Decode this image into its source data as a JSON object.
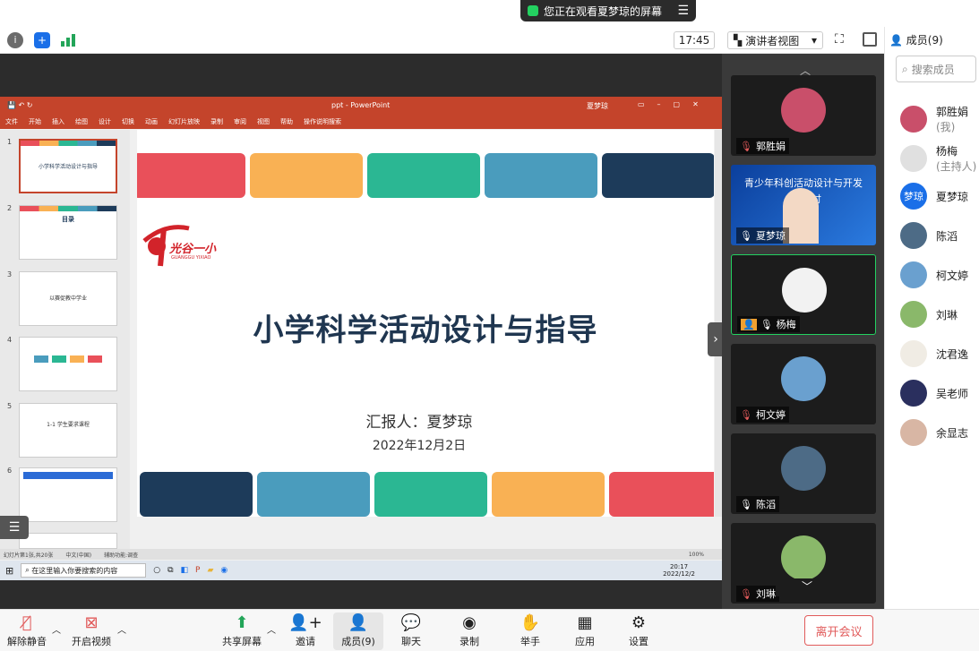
{
  "share_banner": {
    "text": "您正在观看夏梦琼的屏幕"
  },
  "topbar": {
    "time": "17:45",
    "view_mode": "演讲者视图"
  },
  "ppt": {
    "window_title": "ppt - PowerPoint",
    "user": "夏梦琼",
    "ribbon_tabs": [
      "文件",
      "开始",
      "插入",
      "绘图",
      "设计",
      "切换",
      "动画",
      "幻灯片放映",
      "录制",
      "审阅",
      "视图",
      "帮助",
      "操作说明搜索"
    ],
    "thumb_numbers": [
      "1",
      "2",
      "3",
      "4",
      "5",
      "6"
    ],
    "thumb_texts": [
      "小学科学活动设计与指导",
      "目录",
      "以赛促教中学业",
      "",
      "1-1 学生要求课程",
      ""
    ],
    "status": [
      "幻灯片第1张,共20张",
      "中文(中国)",
      "辅助功能:调查"
    ],
    "zoom": "100%"
  },
  "slide": {
    "logo_text": "光谷一小",
    "logo_sub": "GUANGGU YIXIAO",
    "title": "小学科学活动设计与指导",
    "reporter": "汇报人：夏梦琼",
    "date": "2022年12月2日",
    "top_colors": [
      "#e9505a",
      "#f9b154",
      "#2bb793",
      "#4a9cbd",
      "#1d3b5a"
    ],
    "bottom_colors": [
      "#1d3b5a",
      "#4a9cbd",
      "#2bb793",
      "#f9b154",
      "#e9505a"
    ]
  },
  "taskbar": {
    "search_placeholder": "在这里输入你要搜索的内容",
    "clock_time": "20:17",
    "clock_date": "2022/12/2"
  },
  "tiles": [
    {
      "name": "郭胜娟",
      "color": "#c94f6a"
    },
    {
      "name": "夏梦琼",
      "video_text": "青少年科创活动设计与开发",
      "video_text2": "讨",
      "color": "#2b6bd6"
    },
    {
      "name": "杨梅",
      "color": "#f2f2f2"
    },
    {
      "name": "柯文婷",
      "color": "#6aa0cf"
    },
    {
      "name": "陈滔",
      "color": "#4d6b86"
    },
    {
      "name": "刘琳",
      "color": "#8ab86a"
    }
  ],
  "members": {
    "title": "成员(9)",
    "search_placeholder": "搜索成员",
    "list": [
      {
        "name": "郭胜娟",
        "sub": "(我)",
        "color": "#c94f6a"
      },
      {
        "name": "杨梅",
        "sub": "(主持人)",
        "color": "#e0e0e0"
      },
      {
        "name": "夏梦琼",
        "sub": "",
        "color": "#1a6fe8",
        "initials": "梦琼"
      },
      {
        "name": "陈滔",
        "sub": "",
        "color": "#4d6b86"
      },
      {
        "name": "柯文婷",
        "sub": "",
        "color": "#6aa0cf"
      },
      {
        "name": "刘琳",
        "sub": "",
        "color": "#8ab86a"
      },
      {
        "name": "沈君逸",
        "sub": "",
        "color": "#f0ece4"
      },
      {
        "name": "吴老师",
        "sub": "",
        "color": "#2a2f5e"
      },
      {
        "name": "余显志",
        "sub": "",
        "color": "#d8b6a4"
      }
    ]
  },
  "toolbar": {
    "mute": "解除静音",
    "video": "开启视频",
    "share": "共享屏幕",
    "invite": "邀请",
    "members": "成员(9)",
    "chat": "聊天",
    "record": "录制",
    "hand": "举手",
    "apps": "应用",
    "settings": "设置",
    "leave": "离开会议"
  }
}
